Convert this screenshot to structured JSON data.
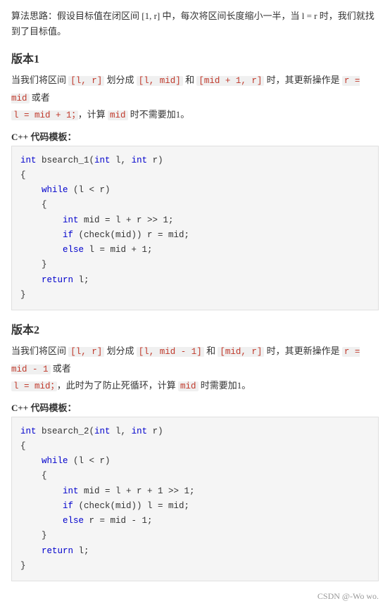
{
  "intro": {
    "text": "算法思路：假设目标值在闭区间 [1, r] 中，每次将区间长度缩小一半，当 l = r 时，我们就找到了目标值。"
  },
  "version1": {
    "title": "版本1",
    "desc_line1": "当我们将区间 [l, r] 划分成 [l, mid] 和 [mid + 1, r] 时，其更新操作是 r = mid 或者",
    "desc_line2": "l = mid + 1；，计算 mid 时不需要加1。",
    "code_label": "C++ 代码模板：",
    "code": "int bsearch_1(int l, int r)\n{\n    while (l < r)\n    {\n        int mid = l + r >> 1;\n        if (check(mid)) r = mid;\n        else l = mid + 1;\n    }\n    return l;\n}"
  },
  "version2": {
    "title": "版本2",
    "desc_line1": "当我们将区间 [l, r] 划分成 [l, mid - 1] 和 [mid, r] 时，其更新操作是 r = mid - 1 或者",
    "desc_line2": "l = mid；，此时为了防止死循环，计算 mid 时需要加1。",
    "code_label": "C++ 代码模板：",
    "code": "int bsearch_2(int l, int r)\n{\n    while (l < r)\n    {\n        int mid = l + r + 1 >> 1;\n        if (check(mid)) l = mid;\n        else r = mid - 1;\n    }\n    return l;\n}"
  },
  "footer": {
    "text": "CSDN @-Wo wo."
  }
}
